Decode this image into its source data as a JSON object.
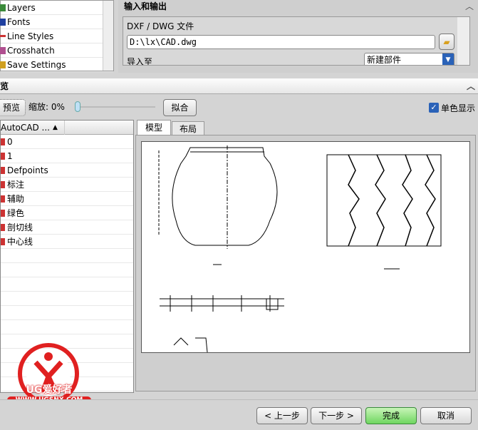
{
  "nav": {
    "items": [
      {
        "label": "Layers",
        "icon": "layers-icon"
      },
      {
        "label": "Fonts",
        "icon": "fonts-icon"
      },
      {
        "label": "Line Styles",
        "icon": "line-styles-icon"
      },
      {
        "label": "Crosshatch",
        "icon": "crosshatch-icon"
      },
      {
        "label": "Save Settings",
        "icon": "save-icon"
      }
    ]
  },
  "io": {
    "title": "输入和输出",
    "file_label": "DXF / DWG 文件",
    "file_value": "D:\\lx\\CAD.dwg",
    "import_label": "导入至",
    "import_value": "新建部件"
  },
  "preview": {
    "title": "览",
    "preview_button": "预览",
    "zoom_label": "缩放: 0%",
    "zoom_percent": 0,
    "fit_button": "拟合",
    "mono_label": "单色显示",
    "mono_checked": true
  },
  "layers": {
    "header": "AutoCAD ...",
    "rows": [
      "0",
      "1",
      "Defpoints",
      "标注",
      "辅助",
      "绿色",
      "剖切线",
      "中心线"
    ]
  },
  "tabs": [
    "模型",
    "布局"
  ],
  "footer": {
    "back": "< 上一步",
    "next": "下一步 >",
    "finish": "完成",
    "cancel": "取消"
  },
  "watermark": {
    "text": "UG爱好者",
    "url": "WWW.UGSNX.COM"
  },
  "colors": {
    "finish": "#7edc6e",
    "accent": "#2a62b8",
    "watermark": "#e02020"
  }
}
